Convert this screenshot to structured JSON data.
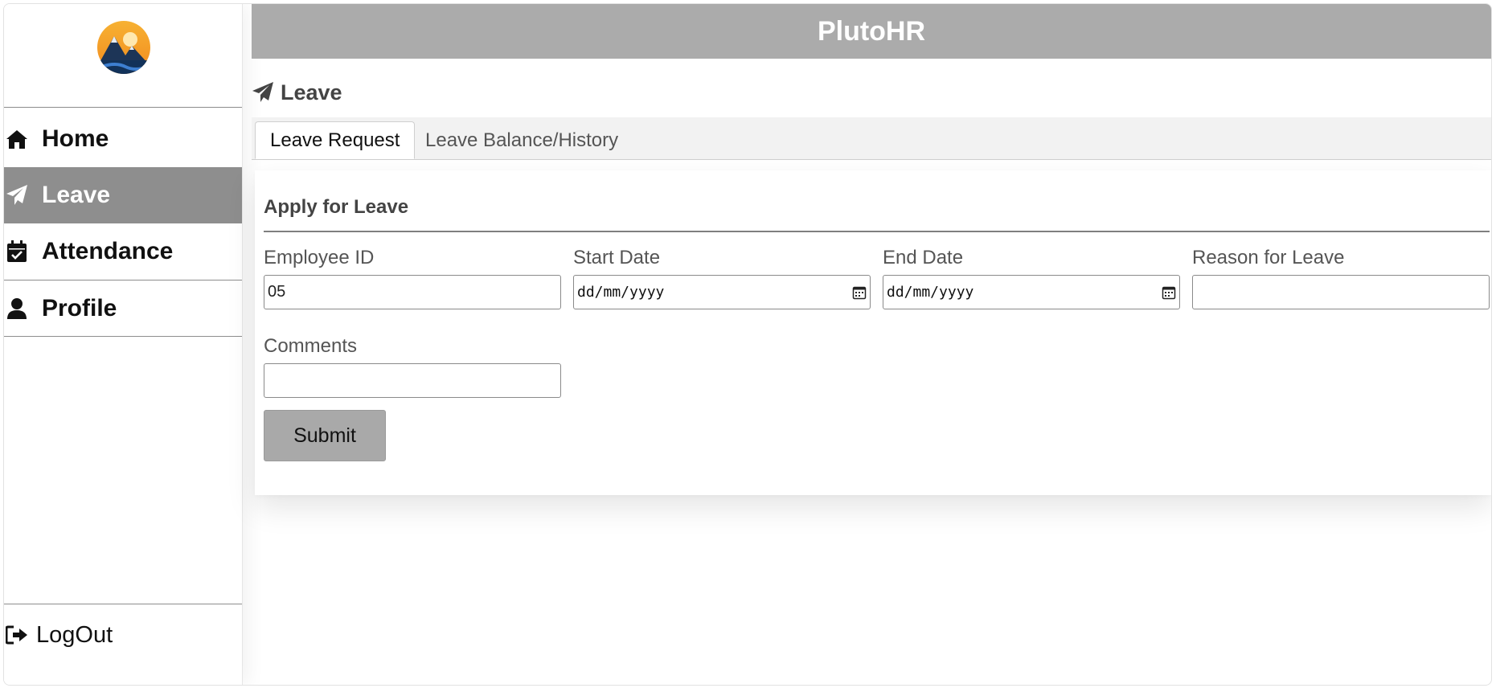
{
  "app": {
    "title": "PlutoHR"
  },
  "sidebar": {
    "items": [
      {
        "label": "Home",
        "icon": "home-icon"
      },
      {
        "label": "Leave",
        "icon": "paper-plane-icon",
        "active": true
      },
      {
        "label": "Attendance",
        "icon": "calendar-check-icon"
      },
      {
        "label": "Profile",
        "icon": "user-icon"
      }
    ],
    "logout": {
      "label": "LogOut",
      "icon": "sign-out-icon"
    }
  },
  "page": {
    "title": "Leave",
    "icon": "paper-plane-icon"
  },
  "tabs": [
    {
      "label": "Leave Request",
      "active": true
    },
    {
      "label": "Leave Balance/History",
      "active": false
    }
  ],
  "form": {
    "title": "Apply for Leave",
    "employee_id": {
      "label": "Employee ID",
      "value": "05"
    },
    "start_date": {
      "label": "Start Date",
      "placeholder": "dd/mm/yyyy"
    },
    "end_date": {
      "label": "End Date",
      "placeholder": "dd/mm/yyyy"
    },
    "reason": {
      "label": "Reason for Leave",
      "value": ""
    },
    "comments": {
      "label": "Comments",
      "value": ""
    },
    "submit_label": "Submit"
  },
  "colors": {
    "header_bg": "#ababab",
    "active_nav_bg": "#8e8e8e",
    "submit_bg": "#a9a9a9"
  }
}
